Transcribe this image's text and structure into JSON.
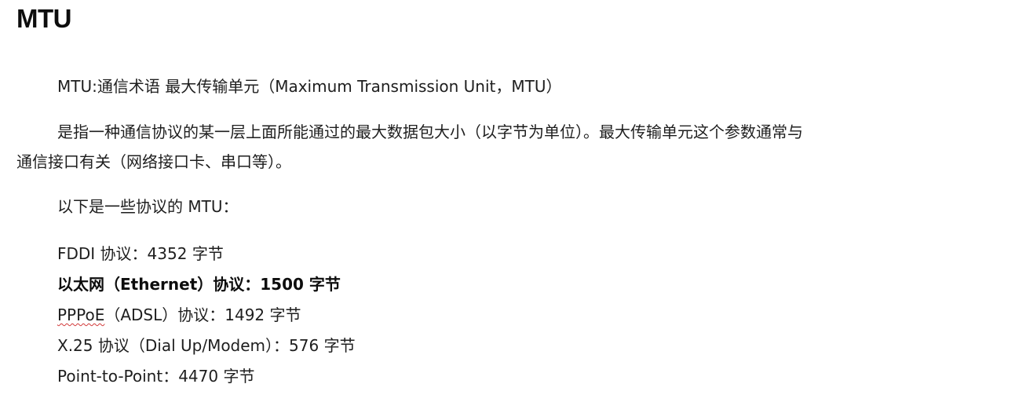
{
  "title": "MTU",
  "definition": "MTU:通信术语 最大传输单元（Maximum Transmission Unit，MTU）",
  "description_line1": "是指一种通信协议的某一层上面所能通过的最大数据包大小（以字节为单位）。最大传输单元这个参数通常与",
  "description_line2": "通信接口有关（网络接口卡、串口等）。",
  "intro": "以下是一些协议的 MTU：",
  "protocols": [
    {
      "text": "FDDI 协议：4352 字节"
    },
    {
      "text": "以太网（Ethernet）协议：1500 字节"
    },
    {
      "name": "PPPoE",
      "text": "（ADSL）协议：1492 字节"
    },
    {
      "text": "X.25 协议（Dial Up/Modem）：576 字节"
    },
    {
      "text": "Point-to-Point：4470 字节"
    }
  ]
}
